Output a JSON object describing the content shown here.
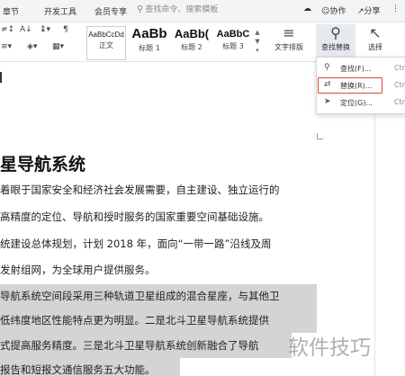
{
  "tabs": {
    "chapter": "章节",
    "dev_tools": "开发工具",
    "member": "会员专享",
    "search_placeholder": "查找命令、搜索模板"
  },
  "header_right": {
    "collab": "协作",
    "share": "分享"
  },
  "styles": {
    "normal_sample": "AaBbCcDd",
    "normal_name": "正文",
    "h1_sample": "AaBb",
    "h1_name": "标题 1",
    "h2_sample": "AaBb(",
    "h2_name": "标题 2",
    "h3_sample": "AaBbC",
    "h3_name": "标题 3"
  },
  "ribbon_buttons": {
    "text_layout": "文字排版",
    "find_replace": "查找替换",
    "select": "选择"
  },
  "find_menu": [
    {
      "label": "查找(F)...",
      "shortcut": "Ctrl",
      "icon": "search-icon"
    },
    {
      "label": "替换(R)...",
      "shortcut": "Ctrl",
      "icon": "replace-icon"
    },
    {
      "label": "定位(G)...",
      "shortcut": "Ctrl",
      "icon": "goto-icon"
    }
  ],
  "document": {
    "title": "星导航系统",
    "lines": [
      "着眼于国家安全和经济社会发展需要，自主建设、独立运行的",
      "高精度的定位、导航和授时服务的国家重要空间基础设施。",
      "统建设总体规划，计划 2018 年，面向“一带一路”沿线及周",
      "发射组网，为全球用户提供服务。",
      "导航系统空间段采用三种轨道卫星组成的混合星座，与其他卫",
      "低纬度地区性能特点更为明显。二是北斗卫星导航系统提供",
      "式提高服务精度。三是北斗卫星导航系统创新融合了导航",
      "报告和短报文通信服务五大功能。"
    ]
  },
  "watermark": "软件技巧"
}
